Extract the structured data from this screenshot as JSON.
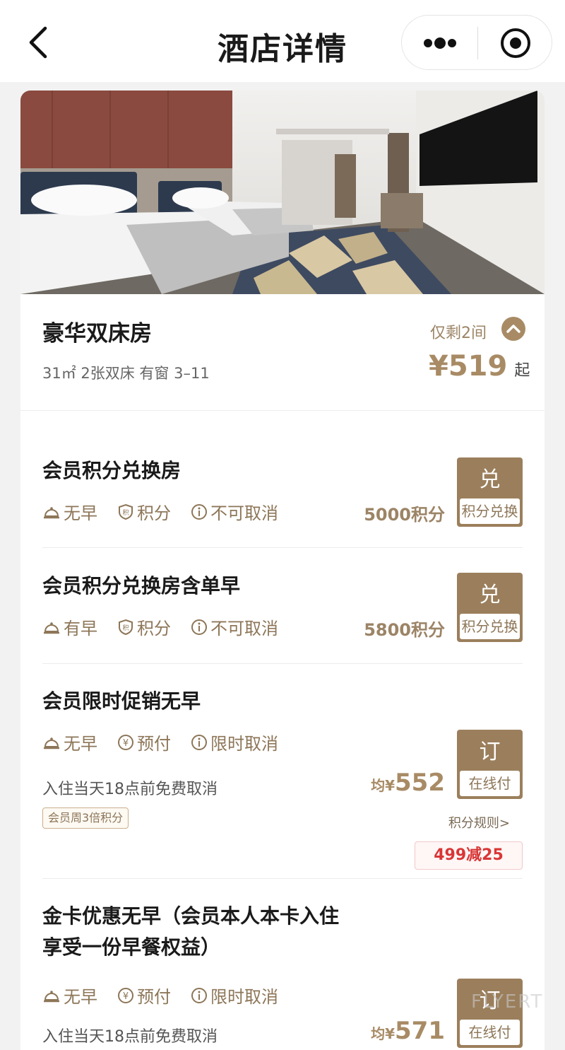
{
  "nav": {
    "title": "酒店详情"
  },
  "room": {
    "name": "豪华双床房",
    "remaining": "仅剩2间",
    "spec": "31㎡ 2张双床 有窗 3–11",
    "price": "¥519",
    "price_suffix": "起"
  },
  "rates": [
    {
      "title": "会员积分兑换房",
      "breakfast": "无早",
      "pay": "积分",
      "cancel": "不可取消",
      "price": "5000积分",
      "button_glyph": "兑",
      "button_sub": "积分兑换"
    },
    {
      "title": "会员积分兑换房含单早",
      "breakfast": "有早",
      "pay": "积分",
      "cancel": "不可取消",
      "price": "5800积分",
      "button_glyph": "兑",
      "button_sub": "积分兑换"
    },
    {
      "title": "会员限时促销无早",
      "breakfast": "无早",
      "pay": "预付",
      "cancel": "限时取消",
      "note": "入住当天18点前免费取消",
      "badge": "会员周3倍积分",
      "rules": "积分规则>",
      "coupon": "499减25",
      "price_prefix": "均¥",
      "price": "552",
      "button_glyph": "订",
      "button_sub": "在线付"
    },
    {
      "title_line1": "金卡优惠无早（会员本人本卡入住",
      "title_line2": "享受一份早餐权益）",
      "breakfast": "无早",
      "pay": "预付",
      "cancel": "限时取消",
      "note": "入住当天18点前免费取消",
      "price_prefix": "均¥",
      "price": "571",
      "button_glyph": "订",
      "button_sub": "在线付"
    }
  ],
  "watermark": "FLYERT",
  "colors": {
    "accent": "#a88b65",
    "button": "#9b7f5c",
    "coupon": "#d93636"
  }
}
